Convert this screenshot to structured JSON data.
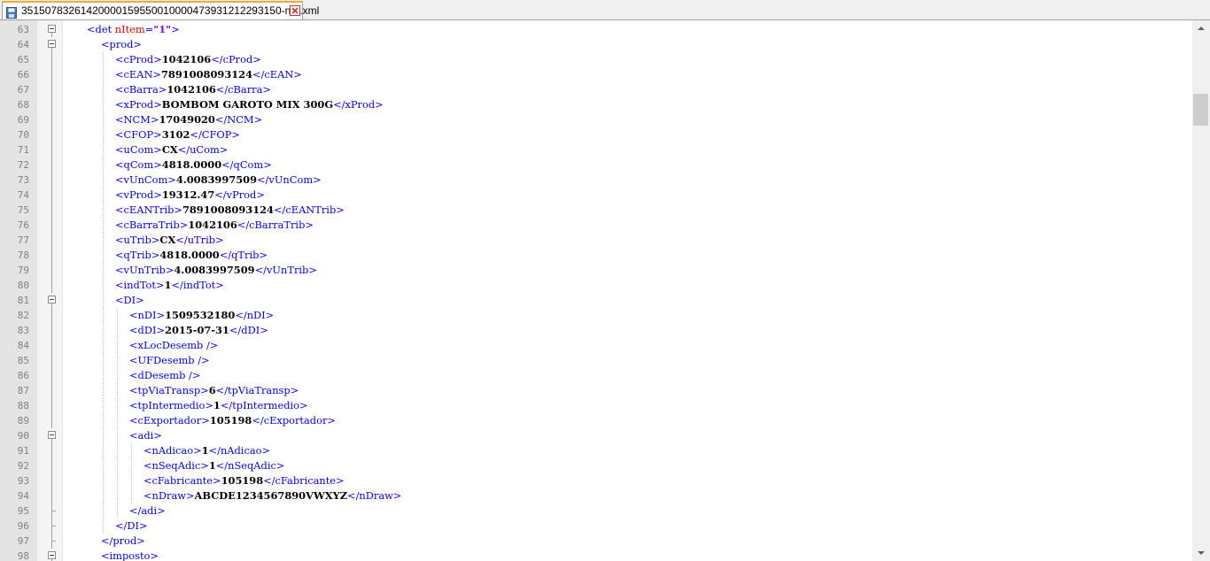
{
  "tab": {
    "title": "35150783261420000159550010000473931212293150-nfe.xml"
  },
  "icons": {
    "tab": "save-file-icon",
    "close": "close-icon",
    "up": "arrow-up-icon",
    "down": "arrow-down-icon"
  },
  "colors": {
    "tag": "#0000ff",
    "text": "#000000",
    "attr": "#ff0000",
    "attr_value": "#8000ff"
  },
  "lines": [
    {
      "num": "63",
      "depth": 1,
      "fold": "box",
      "tag": "det",
      "attr": "nItem",
      "val": "\"1\""
    },
    {
      "num": "64",
      "depth": 2,
      "fold": "box",
      "tag": "prod"
    },
    {
      "num": "65",
      "depth": 3,
      "tag": "cProd",
      "text": "1042106"
    },
    {
      "num": "66",
      "depth": 3,
      "tag": "cEAN",
      "text": "7891008093124"
    },
    {
      "num": "67",
      "depth": 3,
      "tag": "cBarra",
      "text": "1042106"
    },
    {
      "num": "68",
      "depth": 3,
      "tag": "xProd",
      "text": "BOMBOM GAROTO MIX 300G"
    },
    {
      "num": "69",
      "depth": 3,
      "tag": "NCM",
      "text": "17049020"
    },
    {
      "num": "70",
      "depth": 3,
      "tag": "CFOP",
      "text": "3102"
    },
    {
      "num": "71",
      "depth": 3,
      "tag": "uCom",
      "text": "CX"
    },
    {
      "num": "72",
      "depth": 3,
      "tag": "qCom",
      "text": "4818.0000"
    },
    {
      "num": "73",
      "depth": 3,
      "tag": "vUnCom",
      "text": "4.0083997509"
    },
    {
      "num": "74",
      "depth": 3,
      "tag": "vProd",
      "text": "19312.47"
    },
    {
      "num": "75",
      "depth": 3,
      "tag": "cEANTrib",
      "text": "7891008093124"
    },
    {
      "num": "76",
      "depth": 3,
      "tag": "cBarraTrib",
      "text": "1042106"
    },
    {
      "num": "77",
      "depth": 3,
      "tag": "uTrib",
      "text": "CX"
    },
    {
      "num": "78",
      "depth": 3,
      "tag": "qTrib",
      "text": "4818.0000"
    },
    {
      "num": "79",
      "depth": 3,
      "tag": "vUnTrib",
      "text": "4.0083997509"
    },
    {
      "num": "80",
      "depth": 3,
      "tag": "indTot",
      "text": "1"
    },
    {
      "num": "81",
      "depth": 3,
      "fold": "box",
      "tag": "DI"
    },
    {
      "num": "82",
      "depth": 4,
      "tag": "nDI",
      "text": "1509532180"
    },
    {
      "num": "83",
      "depth": 4,
      "tag": "dDI",
      "text": "2015-07-31"
    },
    {
      "num": "84",
      "depth": 4,
      "tag": "xLocDesemb",
      "selfclose": true
    },
    {
      "num": "85",
      "depth": 4,
      "tag": "UFDesemb",
      "selfclose": true
    },
    {
      "num": "86",
      "depth": 4,
      "tag": "dDesemb",
      "selfclose": true
    },
    {
      "num": "87",
      "depth": 4,
      "tag": "tpViaTransp",
      "text": "6"
    },
    {
      "num": "88",
      "depth": 4,
      "tag": "tpIntermedio",
      "text": "1"
    },
    {
      "num": "89",
      "depth": 4,
      "tag": "cExportador",
      "text": "105198"
    },
    {
      "num": "90",
      "depth": 4,
      "fold": "box",
      "tag": "adi"
    },
    {
      "num": "91",
      "depth": 5,
      "tag": "nAdicao",
      "text": "1"
    },
    {
      "num": "92",
      "depth": 5,
      "tag": "nSeqAdic",
      "text": "1"
    },
    {
      "num": "93",
      "depth": 5,
      "tag": "cFabricante",
      "text": "105198"
    },
    {
      "num": "94",
      "depth": 5,
      "tag": "nDraw",
      "text": "ABCDE1234567890VWXYZ"
    },
    {
      "num": "95",
      "depth": 4,
      "fold": "end",
      "closetag": "adi"
    },
    {
      "num": "96",
      "depth": 3,
      "fold": "end",
      "closetag": "DI"
    },
    {
      "num": "97",
      "depth": 2,
      "fold": "end",
      "closetag": "prod"
    },
    {
      "num": "98",
      "depth": 2,
      "fold": "box",
      "tag": "imposto"
    }
  ]
}
